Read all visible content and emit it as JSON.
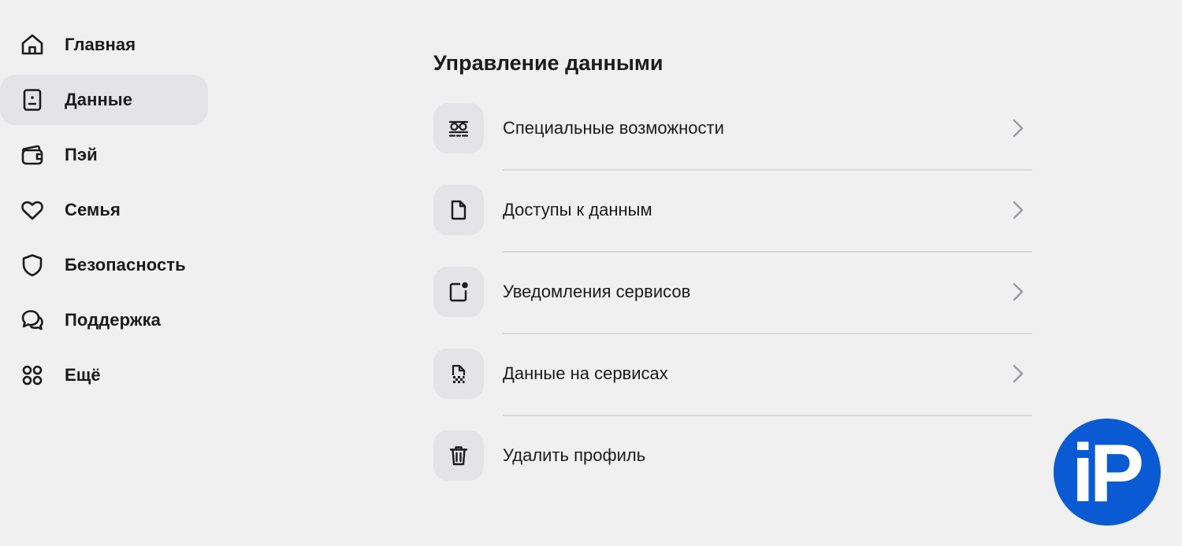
{
  "sidebar": {
    "items": [
      {
        "label": "Главная",
        "icon": "home-icon",
        "active": false
      },
      {
        "label": "Данные",
        "icon": "id-card-icon",
        "active": true
      },
      {
        "label": "Пэй",
        "icon": "wallet-icon",
        "active": false
      },
      {
        "label": "Семья",
        "icon": "heart-icon",
        "active": false
      },
      {
        "label": "Безопасность",
        "icon": "shield-icon",
        "active": false
      },
      {
        "label": "Поддержка",
        "icon": "chat-bubbles-icon",
        "active": false
      },
      {
        "label": "Ещё",
        "icon": "grid-dots-icon",
        "active": false
      }
    ]
  },
  "main": {
    "title": "Управление данными",
    "items": [
      {
        "label": "Специальные возможности",
        "icon": "accessibility-glasses-icon",
        "has_chevron": true
      },
      {
        "label": "Доступы к данным",
        "icon": "document-icon",
        "has_chevron": true
      },
      {
        "label": "Уведомления сервисов",
        "icon": "notification-badge-icon",
        "has_chevron": true
      },
      {
        "label": "Данные на сервисах",
        "icon": "data-file-icon",
        "has_chevron": true
      },
      {
        "label": "Удалить профиль",
        "icon": "trash-icon",
        "has_chevron": false
      }
    ]
  },
  "watermark": {
    "text": "iP",
    "color": "#0a5bd3"
  },
  "colors": {
    "background": "#f0f0f0",
    "active_item": "#e4e4e6",
    "icon_tile": "#e4e4e6",
    "divider": "#d9d9dd",
    "chevron": "#9a9aa2"
  }
}
